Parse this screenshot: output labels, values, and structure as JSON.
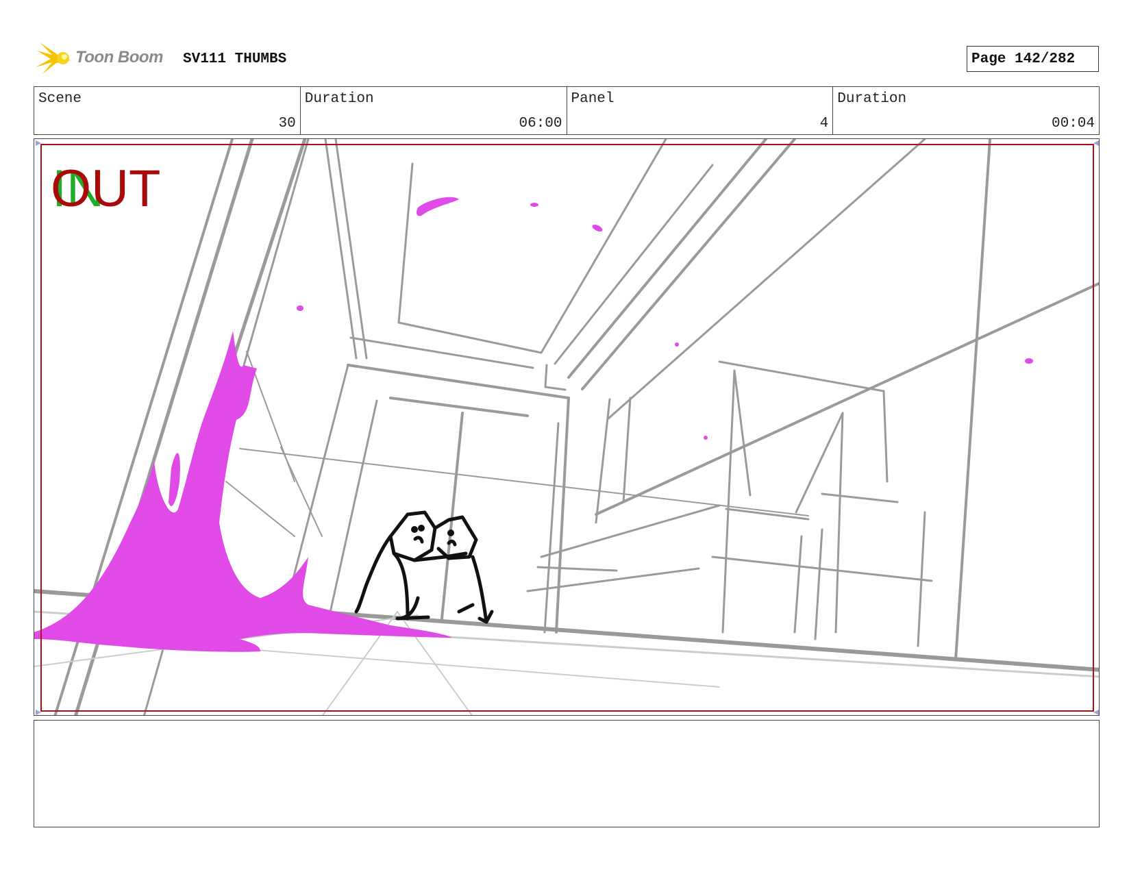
{
  "header": {
    "logo_text": "Toon Boom",
    "project_title": "SV111 THUMBS",
    "page_label": "Page 142/282"
  },
  "info": {
    "scene_label": "Scene",
    "scene_value": "30",
    "scene_duration_label": "Duration",
    "scene_duration_value": "06:00",
    "panel_label": "Panel",
    "panel_value": "4",
    "panel_duration_label": "Duration",
    "panel_duration_value": "00:04"
  },
  "panel": {
    "in_label": "IN",
    "out_label": "OUT"
  },
  "colors": {
    "logo_star": "#f5c400",
    "safe_frame": "#b0101a",
    "in_marker": "#1fae2a",
    "out_marker": "#a80a0a",
    "splash": "#e04be8",
    "sketch_gray": "#9a9a9a",
    "character": "#111111"
  }
}
